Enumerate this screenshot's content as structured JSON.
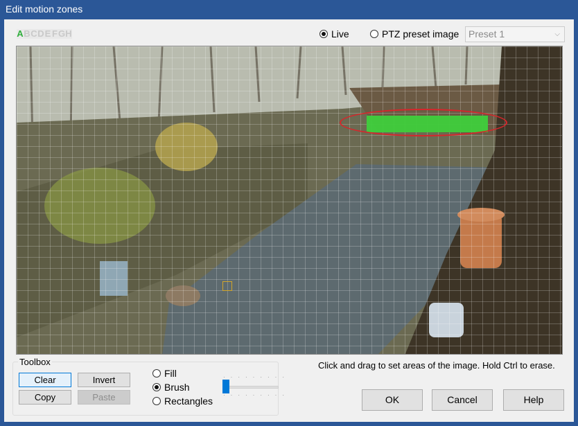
{
  "window": {
    "title": "Edit motion zones"
  },
  "zones": {
    "letters": [
      "A",
      "B",
      "C",
      "D",
      "E",
      "F",
      "G",
      "H"
    ],
    "active": "A"
  },
  "source": {
    "options": [
      {
        "label": "Live",
        "selected": true
      },
      {
        "label": "PTZ preset image",
        "selected": false
      }
    ],
    "preset": {
      "value": "Preset 1",
      "enabled": false
    }
  },
  "toolbox": {
    "label": "Toolbox",
    "buttons": {
      "clear": "Clear",
      "invert": "Invert",
      "copy": "Copy",
      "paste": "Paste"
    },
    "modes": [
      {
        "label": "Fill",
        "selected": false
      },
      {
        "label": "Brush",
        "selected": true
      },
      {
        "label": "Rectangles",
        "selected": false
      }
    ],
    "brush_size_fraction": 0.05
  },
  "hint": "Click and drag to set areas of the image.  Hold Ctrl to erase.",
  "dialog_buttons": {
    "ok": "OK",
    "cancel": "Cancel",
    "help": "Help"
  },
  "colors": {
    "zone_a": "#3fcf3c",
    "annotation": "#d7262b",
    "accent": "#0078d7"
  }
}
